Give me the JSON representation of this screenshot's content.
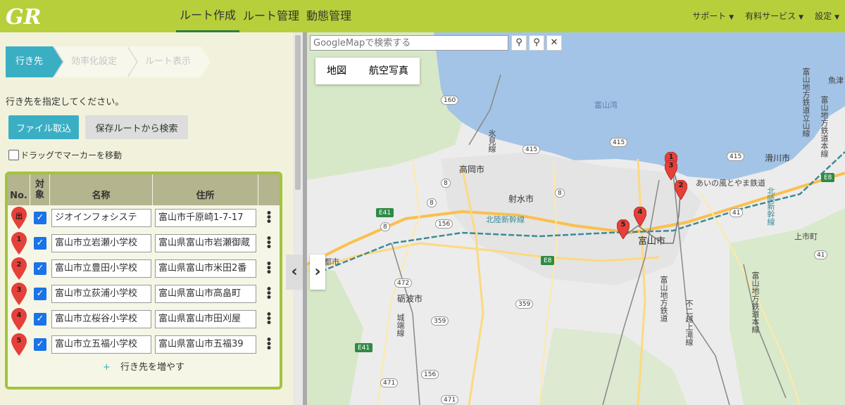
{
  "app": {
    "logo_text": "GR"
  },
  "nav": {
    "tabs": [
      "ルート作成",
      "ルート管理",
      "動態管理"
    ]
  },
  "right_nav": {
    "items": [
      "サポート",
      "有料サービス",
      "設定"
    ]
  },
  "steps": [
    "行き先",
    "効率化設定",
    "ルート表示"
  ],
  "instruction": "行き先を指定してください。",
  "buttons": {
    "file_import": "ファイル取込",
    "from_saved": "保存ルートから検索"
  },
  "drag_label": "ドラッグでマーカーを移動",
  "table": {
    "headers": {
      "no": "No.",
      "target1": "対",
      "target2": "象",
      "name": "名称",
      "address": "住所"
    },
    "rows": [
      {
        "no": "出",
        "name": "ジオインフォシステ",
        "address": "富山市千原崎1-7-17"
      },
      {
        "no": "1",
        "name": "富山市立岩瀬小学校",
        "address": "富山県富山市岩瀬御蔵"
      },
      {
        "no": "2",
        "name": "富山市立豊田小学校",
        "address": "富山県富山市米田2番"
      },
      {
        "no": "3",
        "name": "富山市立荻浦小学校",
        "address": "富山県富山市高畠町"
      },
      {
        "no": "4",
        "name": "富山市立桜谷小学校",
        "address": "富山県富山市田刈屋"
      },
      {
        "no": "5",
        "name": "富山市立五福小学校",
        "address": "富山県富山市五福39"
      }
    ],
    "add_label": "行き先を増やす",
    "add_plus": "+"
  },
  "map": {
    "search_placeholder": "GoogleMapで検索する",
    "types": [
      "地図",
      "航空写真"
    ],
    "labels": {
      "bay": "富山湾",
      "takaoka": "高岡市",
      "imizu": "射水市",
      "toyama": "富山市",
      "tonami": "砺波市",
      "namerikawa": "滑川市",
      "kamiichi": "上市町",
      "uozu": "魚津",
      "aino": "あいの風とやま鉄道",
      "hokuriku1": "北陸新幹線",
      "hokuriku2": "北陸新幹線",
      "himi": "氷見線",
      "johana": "城端線",
      "chitetsu": "富山地方鉄道",
      "chitetsu2": "富山地方鉄道本線",
      "fujiko": "不二越上滝線",
      "nanto": "都市",
      "chitetsu_ichi": "富山地方鉄道立山線",
      "toyama_ken": "富山地方鉄道本線"
    },
    "road_numbers": [
      "160",
      "415",
      "8",
      "8",
      "E41",
      "156",
      "8",
      "E8",
      "472",
      "359",
      "359",
      "E41",
      "156",
      "471",
      "41",
      "415",
      "E8",
      "41",
      "8",
      "415",
      "471"
    ],
    "markers": [
      "1",
      "2",
      "3",
      "4",
      "5",
      "2"
    ]
  },
  "colors": {
    "header": "#b7cf3a",
    "accent": "#3aafc4",
    "table_border": "#a2c43c",
    "pin": "#e5403a",
    "sea": "#a3c4e6"
  }
}
